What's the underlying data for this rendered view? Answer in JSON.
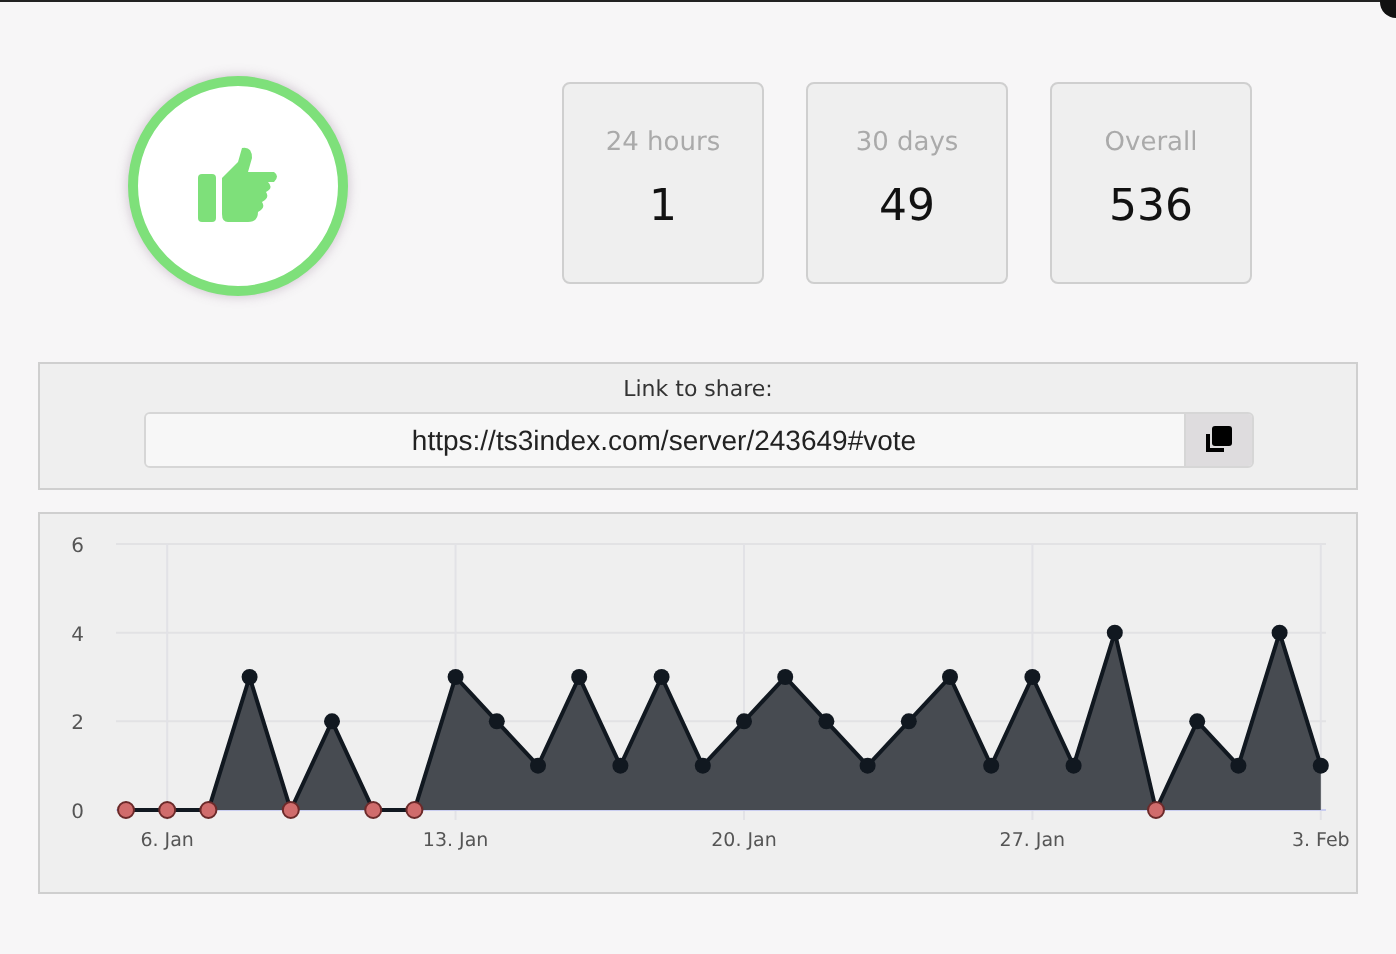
{
  "stats": [
    {
      "label": "24 hours",
      "value": "1"
    },
    {
      "label": "30 days",
      "value": "49"
    },
    {
      "label": "Overall",
      "value": "536"
    }
  ],
  "share": {
    "label": "Link to share:",
    "url": "https://ts3index.com/server/243649#vote"
  },
  "chart_data": {
    "type": "area",
    "categories": [
      null,
      "6. Jan",
      null,
      null,
      null,
      null,
      null,
      null,
      "13. Jan",
      null,
      null,
      null,
      null,
      null,
      null,
      "20. Jan",
      null,
      null,
      null,
      null,
      null,
      null,
      "27. Jan",
      null,
      null,
      null,
      null,
      null,
      null,
      "3. Feb"
    ],
    "series": [
      {
        "color": "#474b51",
        "values": [
          0,
          0,
          0,
          3,
          0,
          2,
          0,
          0,
          3,
          2,
          1,
          3,
          1,
          3,
          1,
          2,
          3,
          2,
          1,
          2,
          3,
          1,
          3,
          1,
          4,
          0,
          2,
          1,
          4,
          1
        ]
      }
    ],
    "ylim": [
      0,
      6
    ],
    "yticks": [
      0,
      2,
      4,
      6
    ],
    "grid": true
  }
}
